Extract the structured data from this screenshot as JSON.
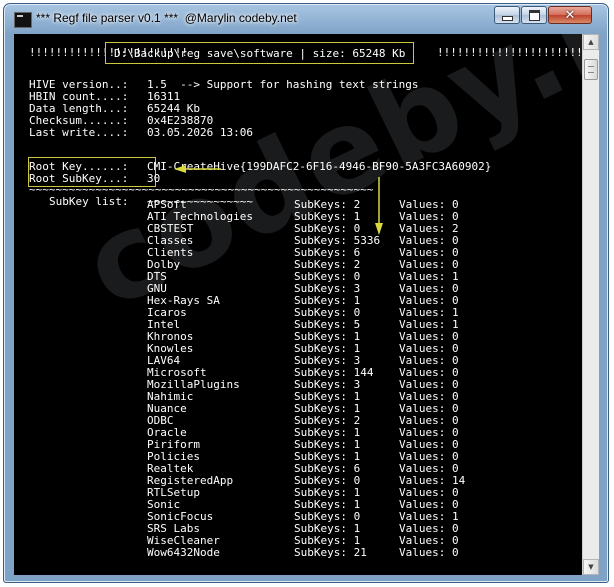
{
  "window": {
    "title": "*** Regf file parser v0.1 ***  @Marylin codeby.net"
  },
  "console": {
    "bang_left": "!!!!!!!!!!!!!!!!!!!!!!!!",
    "path_line": "D:\\Backup\\reg save\\software | size: 65248 Kb",
    "bang_right": "!!!!!!!!!!!!!!!!!!!!!!!!",
    "header": [
      {
        "label": "HIVE version..:",
        "value": "1.5  --> Support for hashing text strings"
      },
      {
        "label": "HBIN count....:",
        "value": "16311"
      },
      {
        "label": "Data length...:",
        "value": "65244 Kb"
      },
      {
        "label": "Checksum......:",
        "value": "0x4E238870"
      },
      {
        "label": "Last write....:",
        "value": "03.05.2026 13:06"
      }
    ],
    "root_key_label": "Root Key......:",
    "root_key_value": "CMI-CreateHive{199DAFC2-6F16-4946-BF90-5A3FC3A60902}",
    "root_subkey_label": "Root SubKey...:",
    "root_subkey_value": "30",
    "tilde_line": "~~~~~~~~~~~~~~~~~~~~~~~~~~~~~~~~~~~~~~~~~~~~~~~~~~~~",
    "subkey_list_label": "SubKey list:",
    "subkey_list_tildes": "~~~~~~~~~~~~~~~~",
    "rows": [
      {
        "name": "APSoft",
        "subkeys": "SubKeys: 2",
        "values": "Values: 0"
      },
      {
        "name": "ATI Technologies",
        "subkeys": "SubKeys: 1",
        "values": "Values: 0"
      },
      {
        "name": "CBSTEST",
        "subkeys": "SubKeys: 0",
        "values": "Values: 2"
      },
      {
        "name": "Classes",
        "subkeys": "SubKeys: 5336",
        "values": "Values: 0"
      },
      {
        "name": "Clients",
        "subkeys": "SubKeys: 6",
        "values": "Values: 0"
      },
      {
        "name": "Dolby",
        "subkeys": "SubKeys: 2",
        "values": "Values: 0"
      },
      {
        "name": "DTS",
        "subkeys": "SubKeys: 0",
        "values": "Values: 1"
      },
      {
        "name": "GNU",
        "subkeys": "SubKeys: 3",
        "values": "Values: 0"
      },
      {
        "name": "Hex-Rays SA",
        "subkeys": "SubKeys: 1",
        "values": "Values: 0"
      },
      {
        "name": "Icaros",
        "subkeys": "SubKeys: 0",
        "values": "Values: 1"
      },
      {
        "name": "Intel",
        "subkeys": "SubKeys: 5",
        "values": "Values: 1"
      },
      {
        "name": "Khronos",
        "subkeys": "SubKeys: 1",
        "values": "Values: 0"
      },
      {
        "name": "Knowles",
        "subkeys": "SubKeys: 1",
        "values": "Values: 0"
      },
      {
        "name": "LAV64",
        "subkeys": "SubKeys: 3",
        "values": "Values: 0"
      },
      {
        "name": "Microsoft",
        "subkeys": "SubKeys: 144",
        "values": "Values: 0"
      },
      {
        "name": "MozillaPlugins",
        "subkeys": "SubKeys: 3",
        "values": "Values: 0"
      },
      {
        "name": "Nahimic",
        "subkeys": "SubKeys: 1",
        "values": "Values: 0"
      },
      {
        "name": "Nuance",
        "subkeys": "SubKeys: 1",
        "values": "Values: 0"
      },
      {
        "name": "ODBC",
        "subkeys": "SubKeys: 2",
        "values": "Values: 0"
      },
      {
        "name": "Oracle",
        "subkeys": "SubKeys: 1",
        "values": "Values: 0"
      },
      {
        "name": "Piriform",
        "subkeys": "SubKeys: 1",
        "values": "Values: 0"
      },
      {
        "name": "Policies",
        "subkeys": "SubKeys: 1",
        "values": "Values: 0"
      },
      {
        "name": "Realtek",
        "subkeys": "SubKeys: 6",
        "values": "Values: 0"
      },
      {
        "name": "RegisteredApp",
        "subkeys": "SubKeys: 0",
        "values": "Values: 14"
      },
      {
        "name": "RTLSetup",
        "subkeys": "SubKeys: 1",
        "values": "Values: 0"
      },
      {
        "name": "Sonic",
        "subkeys": "SubKeys: 1",
        "values": "Values: 0"
      },
      {
        "name": "SonicFocus",
        "subkeys": "SubKeys: 0",
        "values": "Values: 1"
      },
      {
        "name": "SRS Labs",
        "subkeys": "SubKeys: 1",
        "values": "Values: 0"
      },
      {
        "name": "WiseCleaner",
        "subkeys": "SubKeys: 1",
        "values": "Values: 0"
      },
      {
        "name": "Wow6432Node",
        "subkeys": "SubKeys: 21",
        "values": "Values: 0"
      }
    ]
  },
  "watermark": "codeby.net",
  "colors": {
    "console_bg": "#000000",
    "console_text": "#ffffff",
    "highlight": "#c9c93a",
    "window_frame": "#7fa3c7"
  }
}
